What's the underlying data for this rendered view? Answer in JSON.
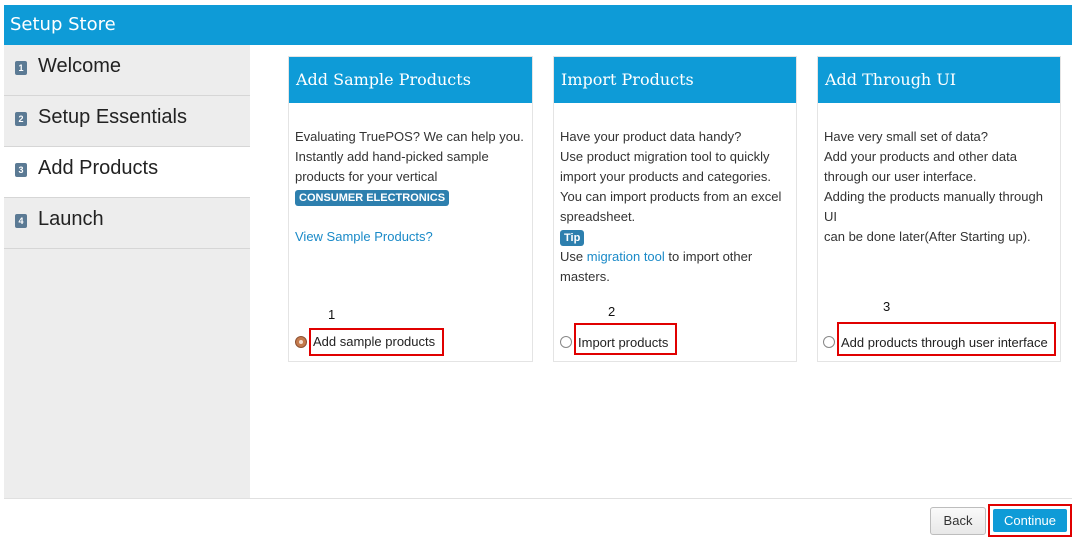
{
  "window": {
    "title": "Setup Store"
  },
  "sidebar": {
    "items": [
      {
        "num": "1",
        "label": "Welcome"
      },
      {
        "num": "2",
        "label": "Setup Essentials"
      },
      {
        "num": "3",
        "label": "Add Products"
      },
      {
        "num": "4",
        "label": "Launch"
      }
    ]
  },
  "cards": {
    "sample": {
      "title": "Add Sample Products",
      "lines": [
        "Evaluating TruePOS? We can help you.",
        "Instantly add hand-picked sample",
        "products for your vertical"
      ],
      "badge": "CONSUMER ELECTRONICS",
      "link": "View Sample Products?",
      "marker": "1",
      "option": "Add sample products"
    },
    "import": {
      "title": "Import Products",
      "lines": [
        "Have your product data handy?",
        "Use product migration tool to quickly",
        "import your products and categories.",
        "You can import products from an excel",
        "spreadsheet."
      ],
      "tip": "Tip",
      "use_prefix": "Use ",
      "use_link": "migration tool",
      "use_suffix": " to import other",
      "use_line2": "masters.",
      "marker": "2",
      "option": "Import products"
    },
    "ui": {
      "title": "Add Through UI",
      "lines": [
        "Have very small set of data?",
        "Add your products and other data",
        "through our user interface.",
        "Adding the products manually through UI",
        "can be done later(After Starting up)."
      ],
      "marker": "3",
      "option": "Add products through user interface"
    }
  },
  "footer": {
    "back": "Back",
    "continue": "Continue"
  },
  "colors": {
    "accent": "#0e9bd7",
    "highlight": "#e00000",
    "badge": "#2d7fae"
  }
}
